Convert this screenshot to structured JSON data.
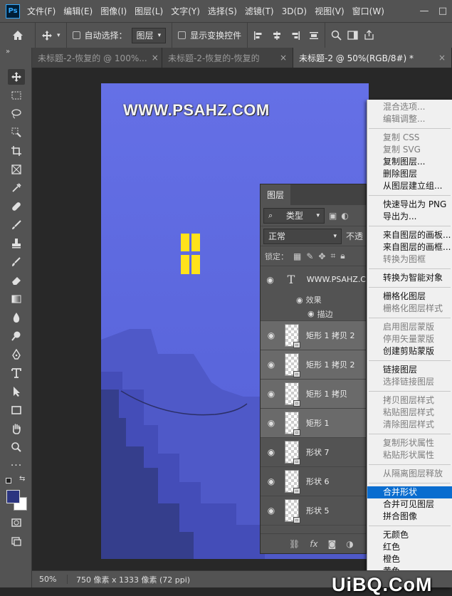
{
  "menubar": {
    "logo": "Ps",
    "items": [
      "文件(F)",
      "编辑(E)",
      "图像(I)",
      "图层(L)",
      "文字(Y)",
      "选择(S)",
      "滤镜(T)",
      "3D(D)",
      "视图(V)",
      "窗口(W)"
    ],
    "win_min": "—",
    "win_max": "□"
  },
  "options": {
    "auto_select_label": "自动选择：",
    "auto_select_value": "图层",
    "show_transform_label": "显示变换控件"
  },
  "tabs": [
    {
      "label": "未标题-2-恢复的 @ 100%...",
      "close": "×"
    },
    {
      "label": "未标题-2-恢复的-恢复的",
      "close": "×"
    },
    {
      "label": "未标题-2 @ 50%(RGB/8#) *",
      "close": "×"
    }
  ],
  "artboard": {
    "text": "WWW.PSAHZ.COM",
    "colors": {
      "sky": "#6570e6",
      "window": "#ffe21a",
      "rock_light": "#4c56c6",
      "rock_dark": "#353e8c"
    }
  },
  "layers_panel": {
    "tab_label": "图层",
    "filter_label": "类型",
    "blend_mode": "正常",
    "opacity_label": "不透",
    "lock_label": "锁定：",
    "text_layer": {
      "name": "WWW.PSAHZ.C",
      "effects_label": "效果",
      "stroke_label": "描边"
    },
    "layers": [
      {
        "name": "矩形 1 拷贝 2"
      },
      {
        "name": "矩形 1 拷贝 2"
      },
      {
        "name": "矩形 1 拷贝"
      },
      {
        "name": "矩形 1"
      },
      {
        "name": "形状 7"
      },
      {
        "name": "形状 6"
      },
      {
        "name": "形状 5"
      }
    ]
  },
  "context_menu": {
    "items": [
      {
        "label": "混合选项...",
        "enabled": false
      },
      {
        "label": "编辑调整...",
        "enabled": false
      },
      {
        "sep": true
      },
      {
        "label": "复制 CSS",
        "enabled": false
      },
      {
        "label": "复制 SVG",
        "enabled": false
      },
      {
        "label": "复制图层...",
        "enabled": true
      },
      {
        "label": "删除图层",
        "enabled": true
      },
      {
        "label": "从图层建立组...",
        "enabled": true
      },
      {
        "sep": true
      },
      {
        "label": "快速导出为 PNG",
        "enabled": true
      },
      {
        "label": "导出为...",
        "enabled": true
      },
      {
        "sep": true
      },
      {
        "label": "来自图层的画板...",
        "enabled": true
      },
      {
        "label": "来自图层的画框...",
        "enabled": true
      },
      {
        "label": "转换为图框",
        "enabled": false
      },
      {
        "sep": true
      },
      {
        "label": "转换为智能对象",
        "enabled": true
      },
      {
        "sep": true
      },
      {
        "label": "栅格化图层",
        "enabled": true
      },
      {
        "label": "栅格化图层样式",
        "enabled": false
      },
      {
        "sep": true
      },
      {
        "label": "启用图层蒙版",
        "enabled": false
      },
      {
        "label": "停用矢量蒙版",
        "enabled": false
      },
      {
        "label": "创建剪贴蒙版",
        "enabled": true
      },
      {
        "sep": true
      },
      {
        "label": "链接图层",
        "enabled": true
      },
      {
        "label": "选择链接图层",
        "enabled": false
      },
      {
        "sep": true
      },
      {
        "label": "拷贝图层样式",
        "enabled": false
      },
      {
        "label": "粘贴图层样式",
        "enabled": false
      },
      {
        "label": "清除图层样式",
        "enabled": false
      },
      {
        "sep": true
      },
      {
        "label": "复制形状属性",
        "enabled": false
      },
      {
        "label": "粘贴形状属性",
        "enabled": false
      },
      {
        "sep": true
      },
      {
        "label": "从隔离图层释放",
        "enabled": false
      },
      {
        "sep": true
      },
      {
        "label": "合并形状",
        "enabled": true,
        "highlighted": true
      },
      {
        "label": "合并可见图层",
        "enabled": true
      },
      {
        "label": "拼合图像",
        "enabled": true
      },
      {
        "sep": true
      },
      {
        "label": "无颜色",
        "enabled": true
      },
      {
        "label": "红色",
        "enabled": true
      },
      {
        "label": "橙色",
        "enabled": true
      },
      {
        "label": "黄色",
        "enabled": true
      }
    ]
  },
  "status": {
    "zoom": "50%",
    "doc_size": "750 像素 x 1333 像素 (72 ppi)"
  },
  "watermark": "UiBQ.CoM"
}
